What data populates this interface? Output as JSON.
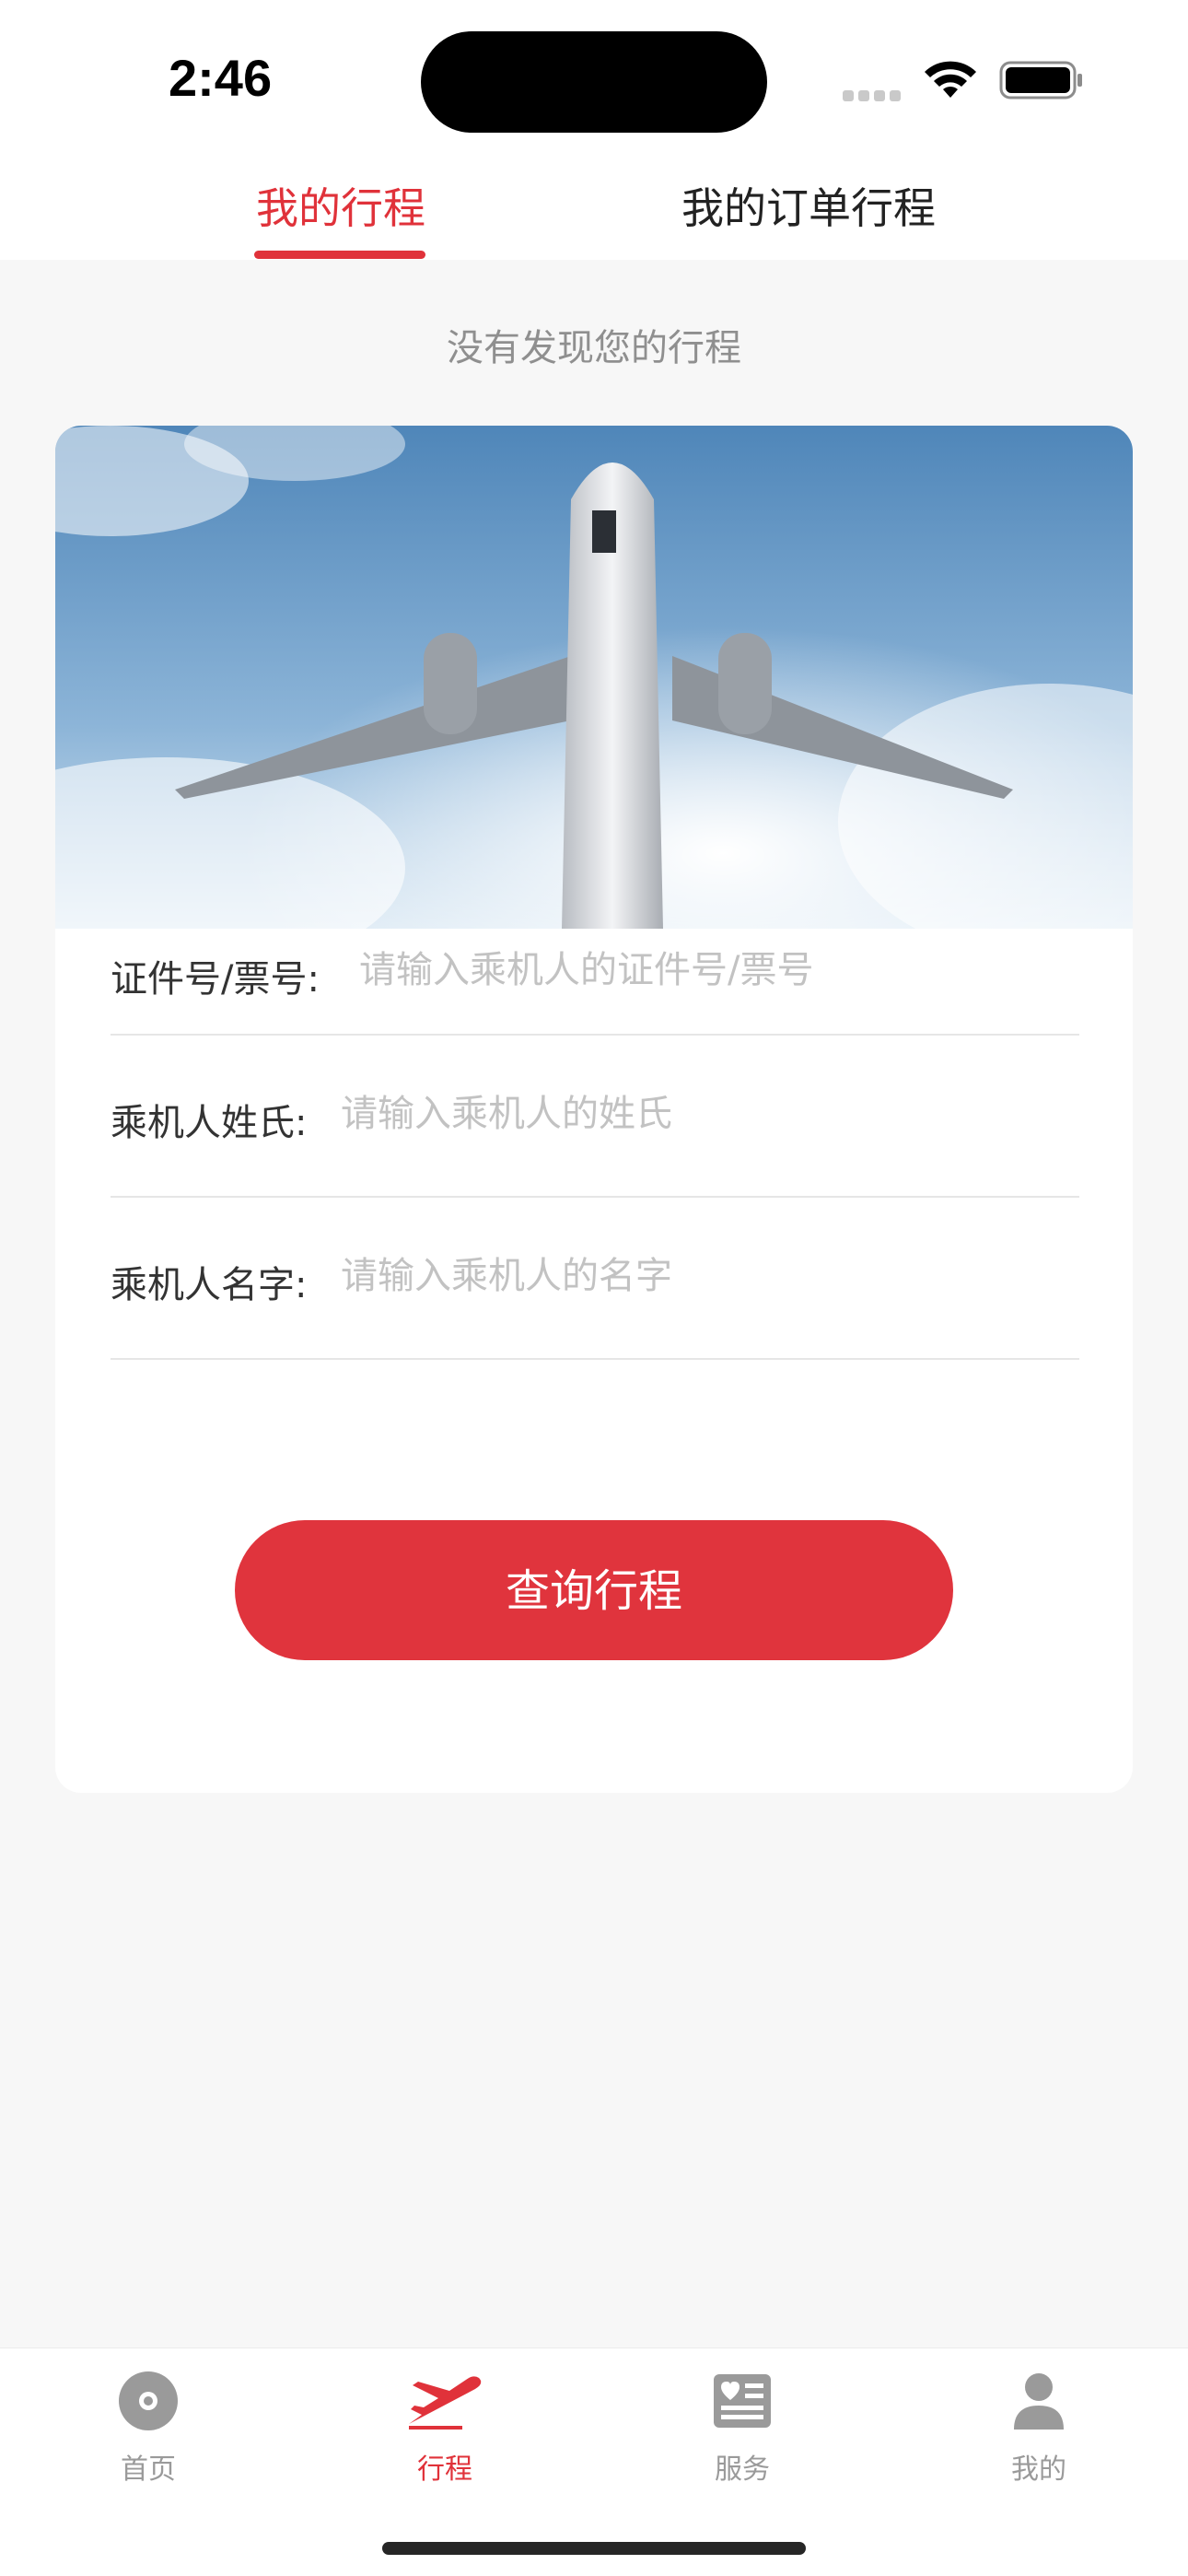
{
  "status_bar": {
    "time": "2:46"
  },
  "top_tabs": {
    "my_trips": "我的行程",
    "order_trips": "我的订单行程"
  },
  "empty_hint": "没有发现您的行程",
  "form": {
    "id_label": "证件号/票号:",
    "id_placeholder": "请输入乘机人的证件号/票号",
    "surname_label": "乘机人姓氏:",
    "surname_placeholder": "请输入乘机人的姓氏",
    "name_label": "乘机人名字:",
    "name_placeholder": "请输入乘机人的名字",
    "submit_label": "查询行程"
  },
  "bottom_nav": {
    "items": [
      {
        "label": "首页",
        "icon": "home-disc-icon",
        "active": false
      },
      {
        "label": "行程",
        "icon": "airplane-icon",
        "active": true
      },
      {
        "label": "服务",
        "icon": "news-icon",
        "active": false
      },
      {
        "label": "我的",
        "icon": "person-icon",
        "active": false
      }
    ]
  },
  "colors": {
    "accent": "#e0323a",
    "background": "#f7f7f7",
    "inactive": "#9a9a9a"
  }
}
